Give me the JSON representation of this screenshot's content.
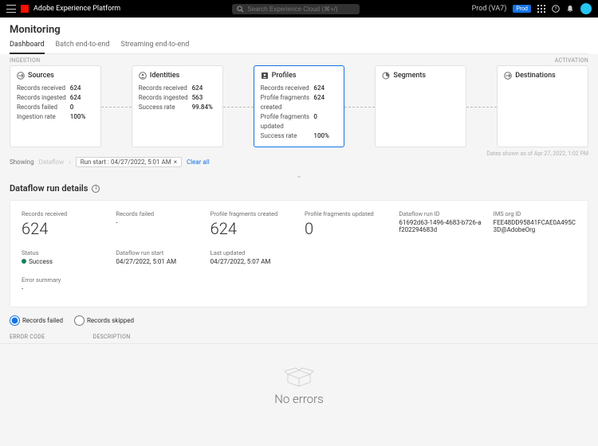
{
  "topbar": {
    "app_name": "Adobe Experience Platform",
    "search_placeholder": "Search Experience Cloud (⌘+/)",
    "env_label": "Prod (VA7)",
    "env_badge": "Prod"
  },
  "page": {
    "title": "Monitoring",
    "tabs": [
      "Dashboard",
      "Batch end-to-end",
      "Streaming end-to-end"
    ]
  },
  "section_labels": {
    "left": "INGESTION",
    "right": "ACTIVATION"
  },
  "pipeline": {
    "sources": {
      "title": "Sources",
      "rows": [
        {
          "label": "Records received",
          "value": "624"
        },
        {
          "label": "Records ingested",
          "value": "624"
        },
        {
          "label": "Records failed",
          "value": "0"
        },
        {
          "label": "Ingestion rate",
          "value": "100%"
        }
      ]
    },
    "identities": {
      "title": "Identities",
      "rows": [
        {
          "label": "Records received",
          "value": "624"
        },
        {
          "label": "Records ingested",
          "value": "563"
        },
        {
          "label": "Success rate",
          "value": "99.84%"
        }
      ]
    },
    "profiles": {
      "title": "Profiles",
      "rows": [
        {
          "label": "Records received",
          "value": "624"
        },
        {
          "label": "Profile fragments created",
          "value": "624"
        },
        {
          "label": "Profile fragments updated",
          "value": "0"
        },
        {
          "label": "Success rate",
          "value": "100%"
        }
      ]
    },
    "segments": {
      "title": "Segments"
    },
    "destinations": {
      "title": "Destinations"
    }
  },
  "filter": {
    "showing": "Showing",
    "crumb": "Dataflow",
    "chip": "Run start : 04/27/2022, 5:01 AM",
    "clear": "Clear all",
    "timestamp_note": "Dates shown as of Apr 27, 2022, 1:02 PM"
  },
  "details": {
    "heading": "Dataflow run details",
    "metrics": {
      "records_received": {
        "label": "Records received",
        "value": "624"
      },
      "records_failed": {
        "label": "Records failed",
        "value": "-"
      },
      "fragments_created": {
        "label": "Profile fragments created",
        "value": "624"
      },
      "fragments_updated": {
        "label": "Profile fragments updated",
        "value": "0"
      },
      "run_id": {
        "label": "Dataflow run ID",
        "value": "61692d63-1496-4683-b726-af202294683d"
      },
      "org_id": {
        "label": "IMS org ID",
        "value": "FEE48DD95841FCAE0A495C3D@AdobeOrg"
      }
    },
    "row2": {
      "status": {
        "label": "Status",
        "value": "Success"
      },
      "run_start": {
        "label": "Dataflow run start",
        "value": "04/27/2022, 5:01 AM"
      },
      "last_updated": {
        "label": "Last updated",
        "value": "04/27/2022, 5:07 AM"
      }
    },
    "error_summary": {
      "label": "Error summary",
      "value": "-"
    }
  },
  "radios": {
    "failed": "Records failed",
    "skipped": "Records skipped"
  },
  "error_table": {
    "col1": "ERROR CODE",
    "col2": "DESCRIPTION"
  },
  "empty": {
    "message": "No errors"
  }
}
